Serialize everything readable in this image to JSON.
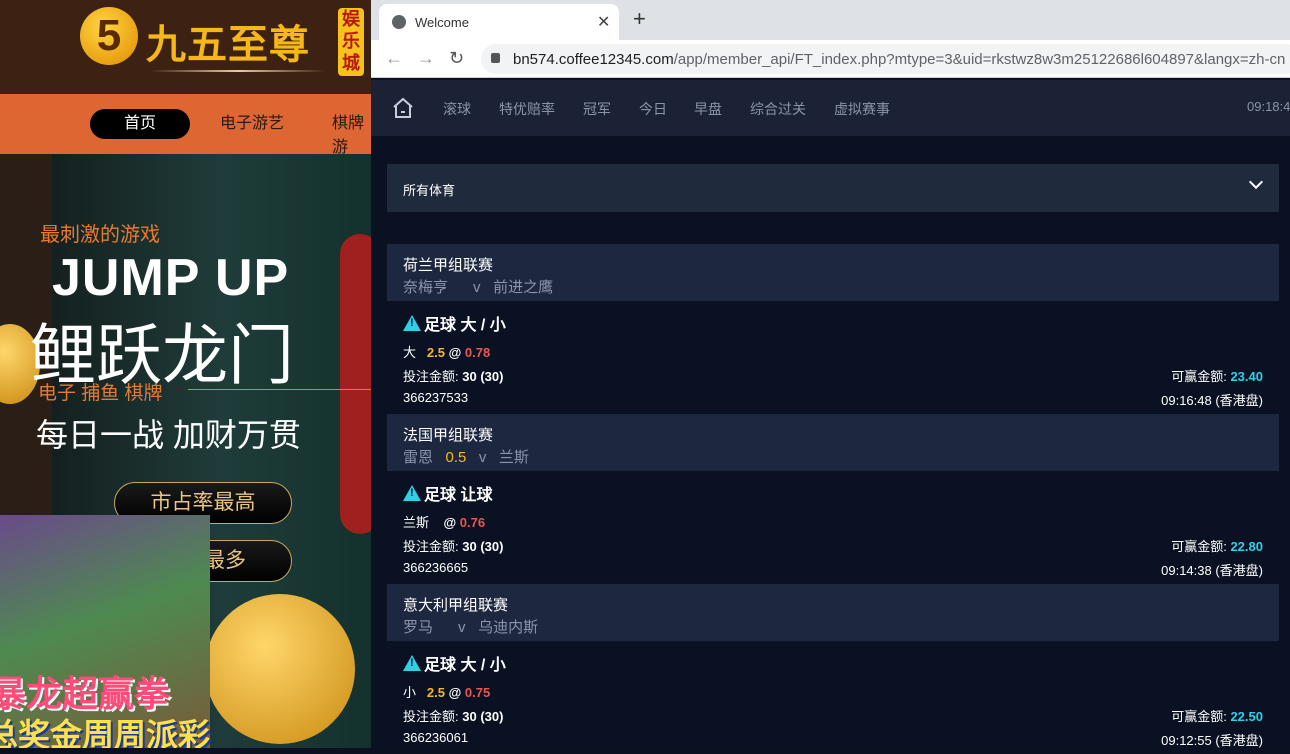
{
  "left": {
    "logo_text": "九五至尊",
    "logo_badge": "娱乐城",
    "nav": [
      "首页",
      "电子游艺",
      "棋牌游"
    ],
    "banner": {
      "tagline": "最刺激的游戏",
      "title_en": "JUMP UP",
      "title_cn": "鲤跃龙门",
      "categories": "电子  捕鱼  棋牌",
      "slogan": "每日一战  加财万贯",
      "btn1": "市占率最高",
      "btn2": "最多",
      "promo1": "暴龙超赢拳",
      "promo2": "总奖金周周派彩"
    }
  },
  "browser": {
    "tab_title": "Welcome",
    "url_host": "bn574.coffee12345.com",
    "url_path": "/app/member_api/FT_index.php?mtype=3&uid=rkstwz8w3m25122686l604897&langx=zh-cn"
  },
  "nav": {
    "items": [
      "滚球",
      "特优赔率",
      "冠军",
      "今日",
      "早盘",
      "综合过关",
      "虚拟赛事"
    ],
    "time": "09:18:4"
  },
  "filter": {
    "label": "所有体育"
  },
  "bets": [
    {
      "league": "荷兰甲组联赛",
      "home": "奈梅亨",
      "vs": "v",
      "handicap": "",
      "away": "前进之鹰",
      "type": "足球 大 / 小",
      "pick": "大",
      "line": "2.5",
      "odds": "0.78",
      "stake_label": "投注金额:",
      "stake": "30 (30)",
      "win_label": "可赢金额:",
      "win": "23.40",
      "id": "366237533",
      "time": "09:16:48 (香港盘)"
    },
    {
      "league": "法国甲组联赛",
      "home": "雷恩",
      "vs": "v",
      "handicap": "0.5",
      "away": "兰斯",
      "type": "足球 让球",
      "pick": "兰斯",
      "line": "",
      "odds": "0.76",
      "stake_label": "投注金额:",
      "stake": "30 (30)",
      "win_label": "可赢金额:",
      "win": "22.80",
      "id": "366236665",
      "time": "09:14:38 (香港盘)"
    },
    {
      "league": "意大利甲组联赛",
      "home": "罗马",
      "vs": "v",
      "handicap": "",
      "away": "乌迪内斯",
      "type": "足球 大 / 小",
      "pick": "小",
      "line": "2.5",
      "odds": "0.75",
      "stake_label": "投注金额:",
      "stake": "30 (30)",
      "win_label": "可赢金额:",
      "win": "22.50",
      "id": "366236061",
      "time": "09:12:55 (香港盘)"
    }
  ]
}
